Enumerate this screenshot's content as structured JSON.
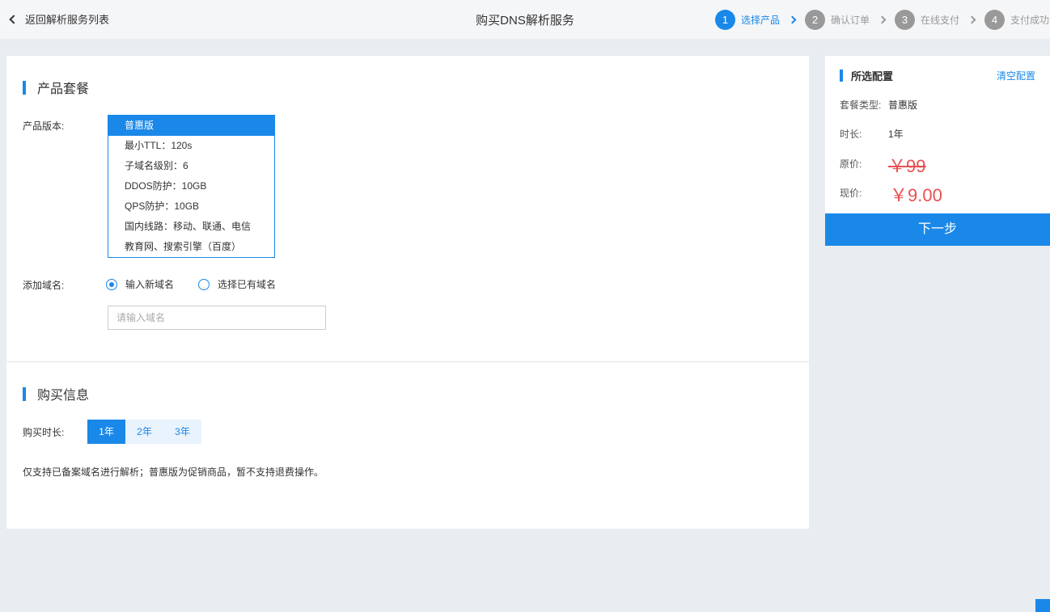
{
  "header": {
    "back_label": "返回解析服务列表",
    "title": "购买DNS解析服务",
    "steps": [
      {
        "num": "1",
        "label": "选择产品"
      },
      {
        "num": "2",
        "label": "确认订单"
      },
      {
        "num": "3",
        "label": "在线支付"
      },
      {
        "num": "4",
        "label": "支付成功"
      }
    ],
    "active_step": 1
  },
  "product": {
    "section_title": "产品套餐",
    "version_label": "产品版本:",
    "plan": {
      "name": "普惠版",
      "features": [
        "最小TTL：120s",
        "子域名级别：6",
        "DDOS防护：10GB",
        "QPS防护：10GB",
        "国内线路：移动、联通、电信",
        "教育网、搜索引擎（百度）"
      ]
    },
    "add_domain_label": "添加域名:",
    "radio_new": "输入新域名",
    "radio_existing": "选择已有域名",
    "domain_placeholder": "请输入域名"
  },
  "purchase": {
    "section_title": "购买信息",
    "duration_label": "购买时长:",
    "durations": [
      "1年",
      "2年",
      "3年"
    ],
    "selected_duration": "1年",
    "notice": "仅支持已备案域名进行解析；普惠版为促销商品，暂不支持退费操作。"
  },
  "summary": {
    "title": "所选配置",
    "clear_label": "清空配置",
    "plan_type_label": "套餐类型:",
    "plan_type_value": "普惠版",
    "duration_label": "时长:",
    "duration_value": "1年",
    "orig_price_label": "原价:",
    "orig_price": "￥99",
    "now_price_label": "现价:",
    "now_price": "￥9.00",
    "next_label": "下一步"
  },
  "colors": {
    "accent": "#1a88e8",
    "price": "#e85050",
    "background": "#e9ecf0"
  }
}
